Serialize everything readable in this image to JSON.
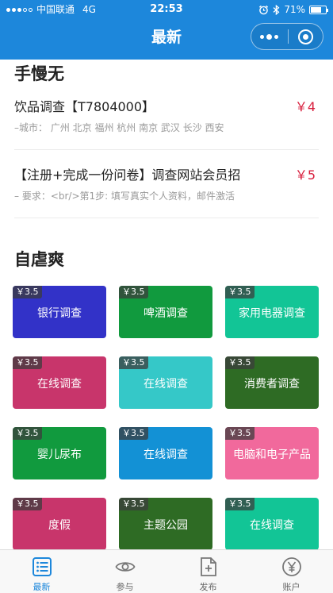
{
  "status_bar": {
    "carrier": "中国联通",
    "network": "4G",
    "time": "22:53",
    "battery_text": "71%",
    "battery_level": 0.71
  },
  "nav": {
    "title": "最新",
    "more_icon": "more-dots-icon",
    "close_icon": "capsule-close-icon"
  },
  "colors": {
    "header": "#1d87db",
    "price": "#d81e3c",
    "tab_active": "#1d87db"
  },
  "section1": {
    "title": "手慢无",
    "items": [
      {
        "title": "饮品调查【T7804000】",
        "price": "￥4",
        "subtitle": "–城市：  广州 北京 福州 杭州 南京 武汉 长沙 西安"
      },
      {
        "title": "【注册+完成一份问卷】调查网站会员招",
        "price": "￥5",
        "subtitle": "– 要求：<br/>第1步: 填写真实个人资料，邮件激活"
      }
    ]
  },
  "section2": {
    "title": "自虐爽",
    "tiles": [
      {
        "price": "￥3.5",
        "label": "银行调查",
        "color": "#3232c8"
      },
      {
        "price": "￥3.5",
        "label": "啤酒调查",
        "color": "#119a3e"
      },
      {
        "price": "￥3.5",
        "label": "家用电器调查",
        "color": "#12c596"
      },
      {
        "price": "￥3.5",
        "label": "在线调查",
        "color": "#c8356b"
      },
      {
        "price": "￥3.5",
        "label": "在线调查",
        "color": "#35c8c8"
      },
      {
        "price": "￥3.5",
        "label": "消费者调查",
        "color": "#2e6b24"
      },
      {
        "price": "￥3.5",
        "label": "婴儿尿布",
        "color": "#119a3e"
      },
      {
        "price": "￥3.5",
        "label": "在线调查",
        "color": "#1391d5"
      },
      {
        "price": "￥3.5",
        "label": "电脑和电子产品",
        "color": "#f1699c"
      },
      {
        "price": "￥3.5",
        "label": "度假",
        "color": "#c8356b"
      },
      {
        "price": "￥3.5",
        "label": "主题公园",
        "color": "#2e6b24"
      },
      {
        "price": "￥3.5",
        "label": "在线调查",
        "color": "#12c596"
      }
    ]
  },
  "tabbar": {
    "tabs": [
      {
        "label": "最新",
        "icon": "list-icon",
        "active": true
      },
      {
        "label": "参与",
        "icon": "eye-icon",
        "active": false
      },
      {
        "label": "发布",
        "icon": "add-document-icon",
        "active": false
      },
      {
        "label": "账户",
        "icon": "yen-coin-icon",
        "active": false
      }
    ]
  }
}
